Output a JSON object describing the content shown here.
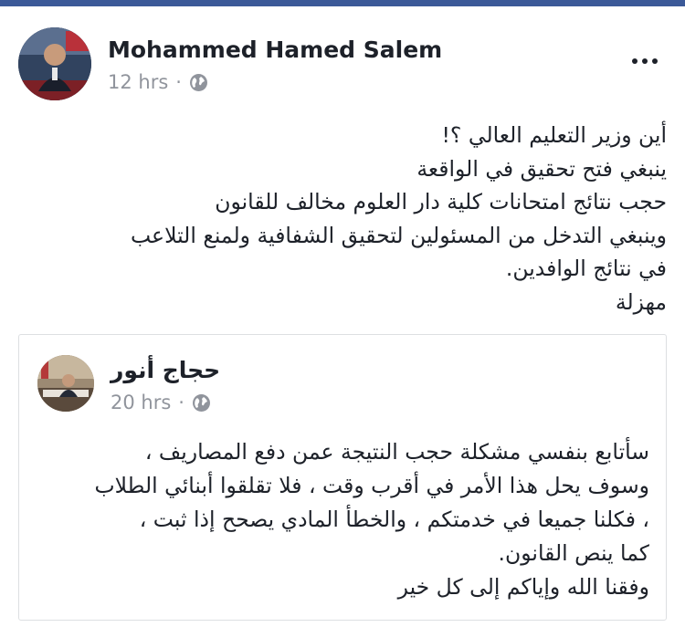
{
  "post": {
    "author": "Mohammed Hamed Salem",
    "time": "12 hrs",
    "dot": "·",
    "privacy_icon": "globe-icon",
    "more_icon": "ellipsis-icon",
    "lines": [
      "أين وزير التعليم العالي ؟!",
      "ينبغي فتح تحقيق في الواقعة",
      "حجب نتائج امتحانات كلية دار العلوم مخالف للقانون",
      "وينبغي التدخل من المسئولين لتحقيق الشفافية ولمنع التلاعب",
      "في نتائج الوافدين.",
      "مهزلة"
    ]
  },
  "shared": {
    "author": "حجاج أنور",
    "time": "20 hrs",
    "dot": "·",
    "privacy_icon": "globe-icon",
    "lines": [
      "سأتابع بنفسي مشكلة حجب النتيجة عمن دفع المصاريف ،",
      "وسوف يحل هذا الأمر في أقرب وقت ، فلا تقلقوا أبنائي الطلاب",
      "، فكلنا جميعا في خدمتكم ، والخطأ المادي يصحح إذا ثبت ،",
      "كما ينص القانون.",
      "وفقنا الله وإياكم إلى كل خير"
    ]
  },
  "colors": {
    "brand_bar": "#3b5998",
    "text": "#1d2129",
    "meta": "#90949c",
    "border": "#dddfe2"
  }
}
